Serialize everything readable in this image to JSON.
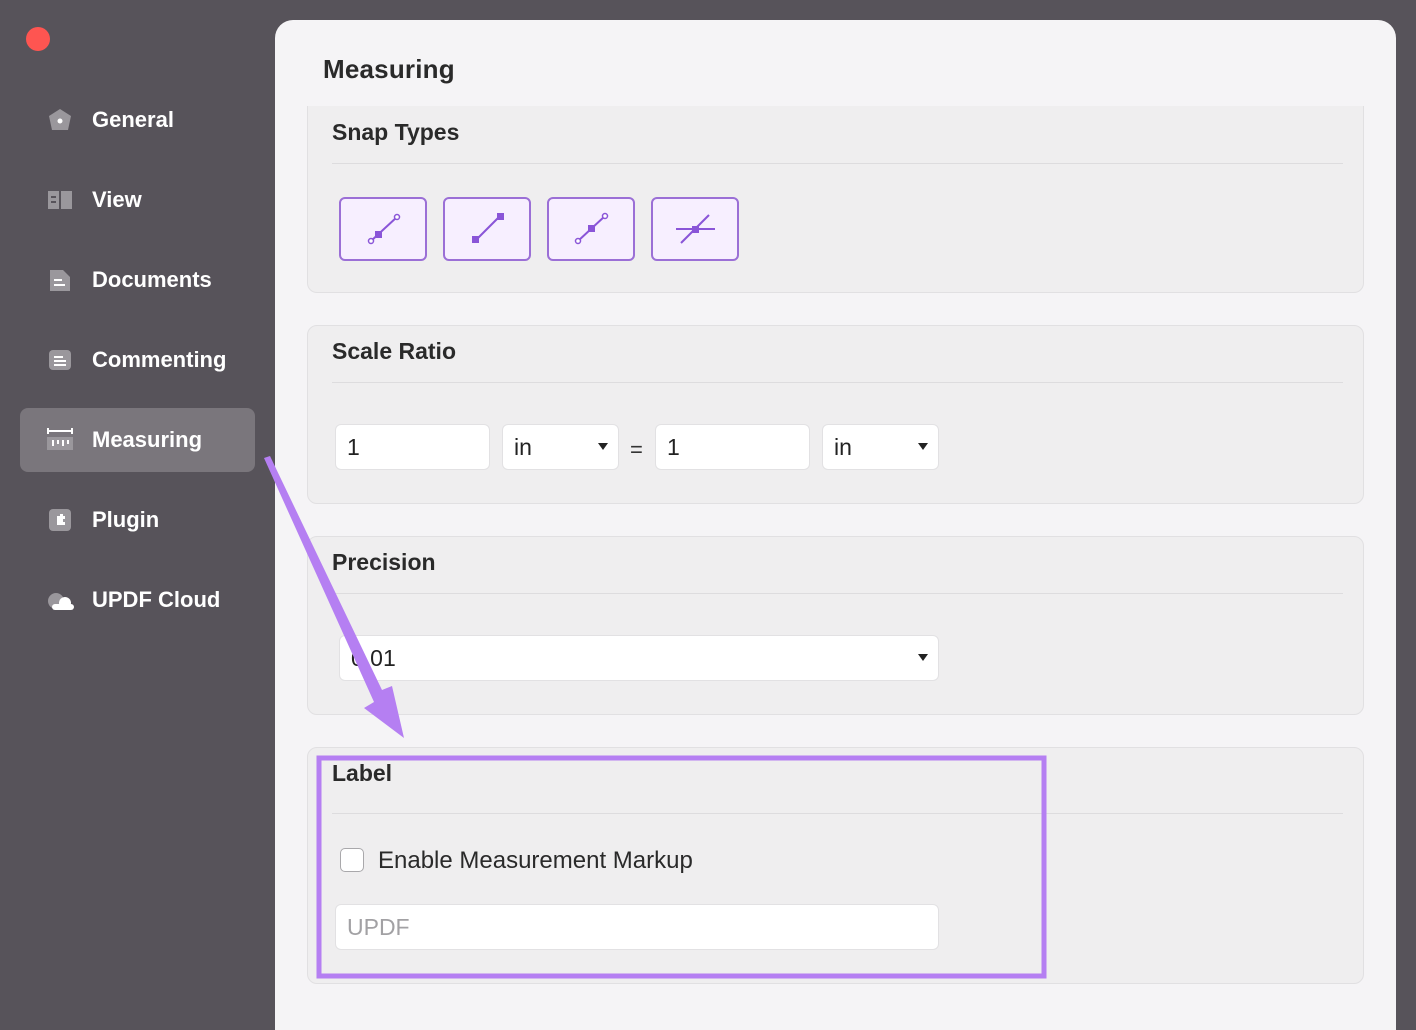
{
  "window": {
    "close_color": "#fe5551"
  },
  "sidebar": {
    "items": [
      {
        "label": "General",
        "icon": "gear-icon"
      },
      {
        "label": "View",
        "icon": "book-icon"
      },
      {
        "label": "Documents",
        "icon": "document-icon"
      },
      {
        "label": "Commenting",
        "icon": "comment-icon"
      },
      {
        "label": "Measuring",
        "icon": "ruler-icon",
        "active": true
      },
      {
        "label": "Plugin",
        "icon": "puzzle-icon"
      },
      {
        "label": "UPDF Cloud",
        "icon": "cloud-icon"
      }
    ]
  },
  "main": {
    "title": "Measuring",
    "snap_types": {
      "title": "Snap Types",
      "buttons": [
        "snap-to-path-icon",
        "snap-to-endpoint-icon",
        "snap-to-midpoint-icon",
        "snap-to-intersection-icon"
      ],
      "accent": "#9b6fd6"
    },
    "scale_ratio": {
      "title": "Scale Ratio",
      "left_value": "1",
      "left_unit": "in",
      "equals": "=",
      "right_value": "1",
      "right_unit": "in"
    },
    "precision": {
      "title": "Precision",
      "value": "0.01"
    },
    "label": {
      "title": "Label",
      "checkbox_label": "Enable Measurement Markup",
      "checked": false,
      "input_placeholder": "UPDF"
    }
  },
  "annotation": {
    "color": "#b57ff2"
  }
}
